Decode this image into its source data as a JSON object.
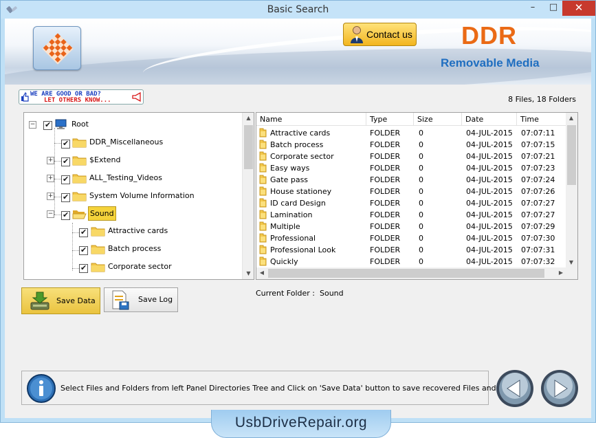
{
  "window": {
    "title": "Basic Search",
    "min_glyph": "–",
    "max_glyph": "□",
    "close_glyph": "✕"
  },
  "header": {
    "contact_label": "Contact us",
    "brand": "DDR",
    "brand_sub": "Removable Media"
  },
  "feedback": {
    "line1": "WE ARE GOOD OR BAD?",
    "line2": "LET OTHERS KNOW..."
  },
  "summary": {
    "file_count": "8 Files, 18 Folders"
  },
  "tree": {
    "root": "Root",
    "items": [
      {
        "label": "DDR_Miscellaneous",
        "expander": ""
      },
      {
        "label": "$Extend",
        "expander": "+"
      },
      {
        "label": "ALL_Testing_Videos",
        "expander": "+"
      },
      {
        "label": "System Volume Information",
        "expander": "+"
      },
      {
        "label": "Sound",
        "expander": "−",
        "selected": true
      }
    ],
    "children": [
      "Attractive cards",
      "Batch process",
      "Corporate sector"
    ]
  },
  "list": {
    "columns": [
      "Name",
      "Type",
      "Size",
      "Date",
      "Time"
    ],
    "rows": [
      {
        "name": "Attractive cards",
        "type": "FOLDER",
        "size": "0",
        "date": "04-JUL-2015",
        "time": "07:07:11"
      },
      {
        "name": "Batch process",
        "type": "FOLDER",
        "size": "0",
        "date": "04-JUL-2015",
        "time": "07:07:15"
      },
      {
        "name": "Corporate sector",
        "type": "FOLDER",
        "size": "0",
        "date": "04-JUL-2015",
        "time": "07:07:21"
      },
      {
        "name": "Easy ways",
        "type": "FOLDER",
        "size": "0",
        "date": "04-JUL-2015",
        "time": "07:07:23"
      },
      {
        "name": "Gate pass",
        "type": "FOLDER",
        "size": "0",
        "date": "04-JUL-2015",
        "time": "07:07:24"
      },
      {
        "name": "House stationey",
        "type": "FOLDER",
        "size": "0",
        "date": "04-JUL-2015",
        "time": "07:07:26"
      },
      {
        "name": "ID card Design",
        "type": "FOLDER",
        "size": "0",
        "date": "04-JUL-2015",
        "time": "07:07:27"
      },
      {
        "name": "Lamination",
        "type": "FOLDER",
        "size": "0",
        "date": "04-JUL-2015",
        "time": "07:07:27"
      },
      {
        "name": "Multiple",
        "type": "FOLDER",
        "size": "0",
        "date": "04-JUL-2015",
        "time": "07:07:29"
      },
      {
        "name": "Professional",
        "type": "FOLDER",
        "size": "0",
        "date": "04-JUL-2015",
        "time": "07:07:30"
      },
      {
        "name": "Professional Look",
        "type": "FOLDER",
        "size": "0",
        "date": "04-JUL-2015",
        "time": "07:07:31"
      },
      {
        "name": "Quickly",
        "type": "FOLDER",
        "size": "0",
        "date": "04-JUL-2015",
        "time": "07:07:32"
      }
    ]
  },
  "actions": {
    "save_data": "Save Data",
    "save_log": "Save Log"
  },
  "current_folder": {
    "label": "Current Folder :",
    "value": "Sound"
  },
  "status": {
    "message": "Select Files and Folders from left Panel Directories Tree and Click on 'Save Data' button to save recovered Files and Folders."
  },
  "footer": {
    "site": "UsbDriveRepair.org"
  },
  "colors": {
    "brand_orange": "#ea6a15",
    "brand_blue": "#1f6ec0",
    "selection_yellow": "#f5d33b",
    "window_frame": "#bfe0f6"
  }
}
